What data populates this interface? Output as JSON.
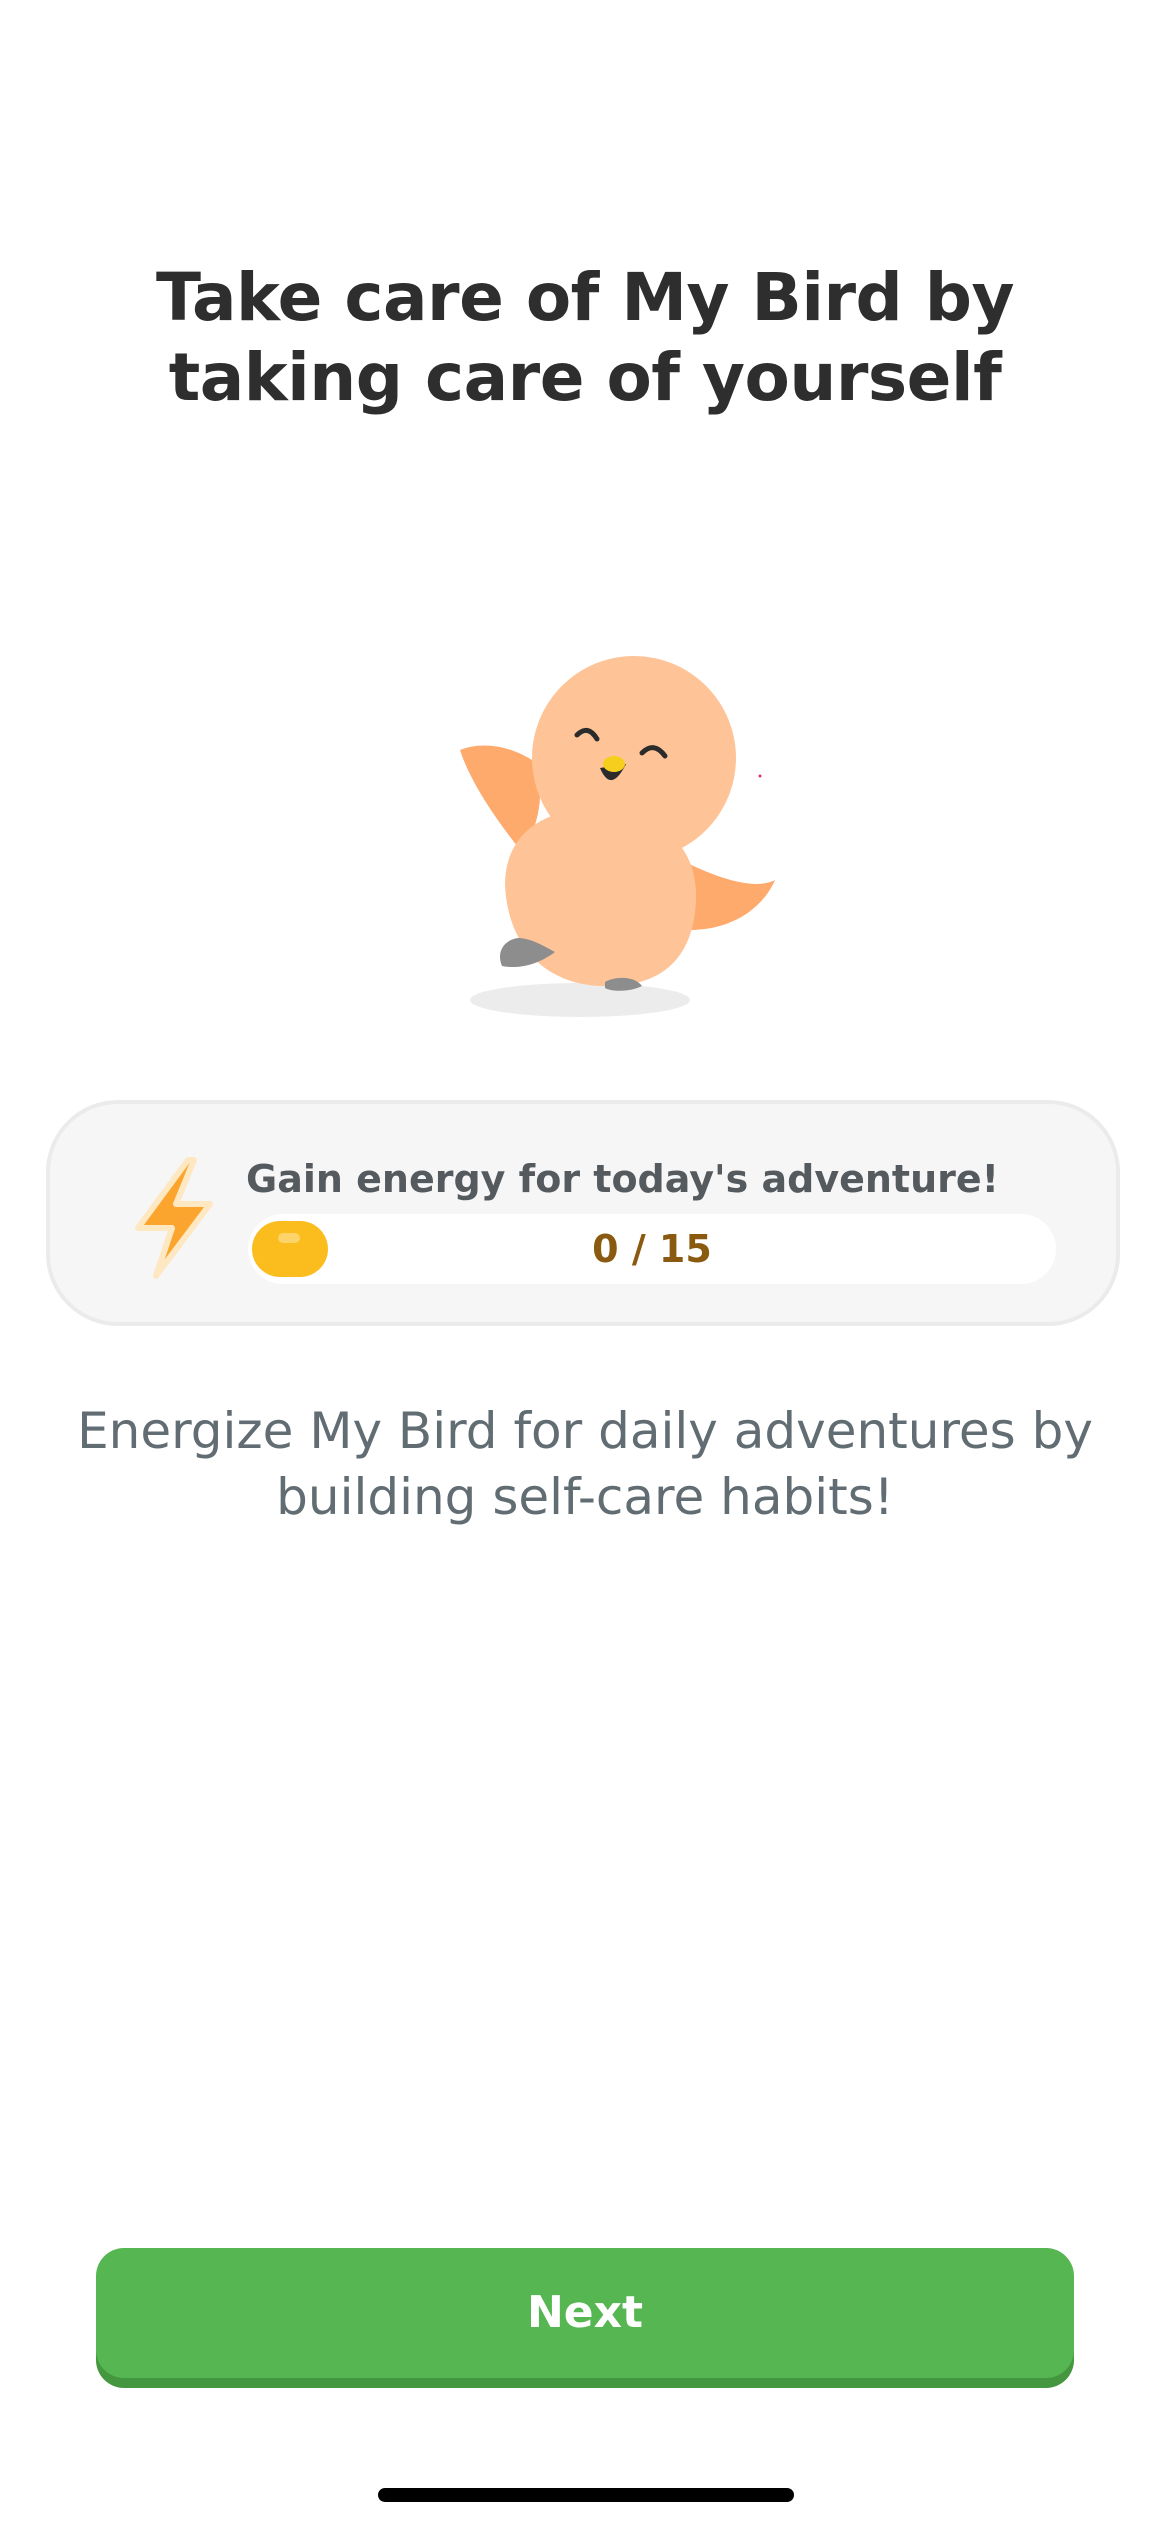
{
  "onboarding": {
    "title": "Take care of My Bird by taking care of yourself",
    "mascot_icon": "happy-bird-mascot",
    "energy": {
      "icon": "lightning-bolt-icon",
      "label": "Gain energy for today's adventure!",
      "current": 0,
      "max": 15,
      "progress_text": "0 / 15",
      "progress_fraction": 0,
      "fill_color": "#fbbd1e"
    },
    "description": "Energize My Bird for daily adventures by building self-care habits!",
    "next_button_label": "Next",
    "colors": {
      "primary_button": "#56b752",
      "primary_button_shadow": "#44973f",
      "title_text": "#2e2e2e",
      "body_text": "#616d73"
    }
  }
}
